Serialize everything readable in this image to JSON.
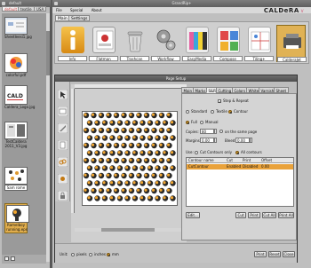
{
  "left_panel": {
    "window_title": "default",
    "tabs": [
      "default",
      "textile",
      "USA"
    ],
    "active_tab": "default",
    "files": [
      {
        "name": "Sheetleesi1.jpg"
      },
      {
        "name": "colorful.pdf"
      },
      {
        "name": "Caldera_Logo.jpg"
      },
      {
        "name": "TestCaldera 2011_V3.jpg"
      },
      {
        "name": "Sam rome"
      },
      {
        "name": "Ramelboy running.eps"
      }
    ]
  },
  "main_window": {
    "title": "GrandRip+",
    "menu": [
      "File",
      "Special",
      "About"
    ],
    "logo": "CALDeRA",
    "logo_version": "V",
    "tabs": [
      "Main",
      "Settings"
    ],
    "active_tab": "Main",
    "tools": [
      {
        "label": "Info",
        "icon": "info-icon"
      },
      {
        "label": "Flatman",
        "icon": "flatman-icon"
      },
      {
        "label": "Trashcan",
        "icon": "trashcan-icon"
      },
      {
        "label": "Workflow",
        "icon": "workflow-icon"
      },
      {
        "label": "EasyMedia",
        "icon": "easymedia-icon"
      },
      {
        "label": "Compose",
        "icon": "compose-icon"
      },
      {
        "label": "Tiling+",
        "icon": "tiling-icon"
      },
      {
        "label": "CalderaJet",
        "icon": "calderajet-icon"
      }
    ],
    "selected_tool": "CalderaJet"
  },
  "dialog": {
    "title": "Page Setup",
    "tabs": [
      "Main",
      "Marks",
      "S&R",
      "Cutting",
      "Colors",
      "White",
      "Varnish",
      "Sheet"
    ],
    "active_tab": "S&R",
    "step_repeat_label": "Step & Repeat",
    "mode_options": [
      "Standard",
      "Textile",
      "Contour"
    ],
    "selected_mode": "Contour",
    "fill_options": [
      "Full",
      "Manual"
    ],
    "selected_fill": "Full",
    "copies_label": "Copies:",
    "copies_value": "80",
    "copies_suffix": "on the same page",
    "margins_label": "Margins:",
    "margins_value": "0.00",
    "bleed_label": "Bleed:",
    "bleed_value": "0.00",
    "use_label": "Use:",
    "use_options": [
      "Cut Contours only",
      "All contours"
    ],
    "selected_use": "All contours",
    "table": {
      "headers": [
        "Contour name",
        "Cut",
        "Print",
        "Offset"
      ],
      "rows": [
        {
          "name": "CutContour",
          "cut": "Enabled",
          "print": "Disabled",
          "offset": "0.00"
        }
      ]
    },
    "buttons": {
      "edit": "Edit...",
      "cut": "Cut",
      "print": "Print",
      "cut_all": "Cut All",
      "print_all": "Print All"
    },
    "unit_label": "Unit:",
    "unit_options": [
      "pixels",
      "inches",
      "mm"
    ],
    "selected_unit": "mm",
    "footer": {
      "print": "Print",
      "reset": "Reset",
      "close": "Close"
    }
  },
  "colors": {
    "accent_orange": "#e9a23b",
    "selected_tool_bg": "#e0b255",
    "tab_active_red": "#c44"
  }
}
